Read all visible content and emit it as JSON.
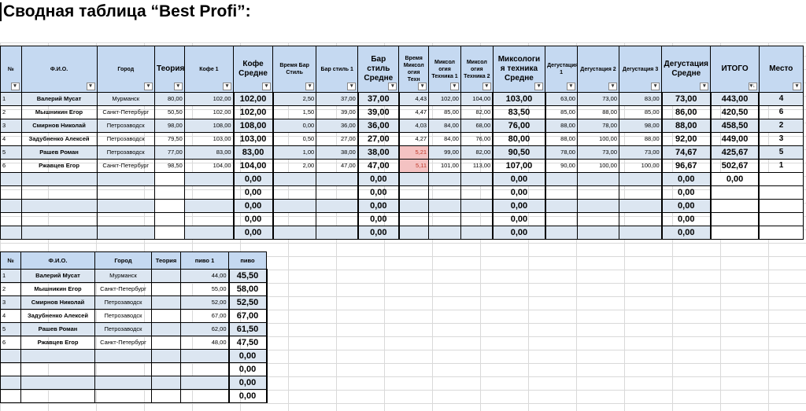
{
  "title": "Сводная таблица “Best Profi”:",
  "table1": {
    "headers": {
      "num": "№",
      "fio": "Ф.И.О.",
      "city": "Город",
      "theory": "Теория",
      "coffee1": "Кофе 1",
      "coffee_avg": "Кофе Средне",
      "time_bar": "Время Бар Стиль",
      "bar1": "Бар стиль 1",
      "bar_avg": "Бар стиль Средне",
      "time_mix": "Время Миксол огия Техн",
      "mix1": "Миксол огия Техника 1",
      "mix2": "Миксол огия Техника 2",
      "mix_avg": "Миксологи я техника Средне",
      "deg1": "Дегустация 1",
      "deg2": "Дегустация 2",
      "deg3": "Дегустация 3",
      "deg_avg": "Дегустация Средне",
      "total": "ИТОГО",
      "place": "Место"
    },
    "rows": [
      {
        "n": "1",
        "fio": "Валерий Мусат",
        "city": "Мурманск",
        "theory": "80,00",
        "coffee1": "102,00",
        "coffee_avg": "102,00",
        "time_bar": "2,50",
        "bar1": "37,00",
        "bar_avg": "37,00",
        "time_mix": "4,43",
        "mix1": "102,00",
        "mix2": "104,00",
        "mix_avg": "103,00",
        "deg1": "63,00",
        "deg2": "73,00",
        "deg3": "83,00",
        "deg_avg": "73,00",
        "total": "443,00",
        "place": "4"
      },
      {
        "n": "2",
        "fio": "Мышникин Егор",
        "city": "Санкт-Петербург",
        "theory": "50,50",
        "coffee1": "102,00",
        "coffee_avg": "102,00",
        "time_bar": "1,50",
        "bar1": "39,00",
        "bar_avg": "39,00",
        "time_mix": "4,47",
        "mix1": "85,00",
        "mix2": "82,00",
        "mix_avg": "83,50",
        "deg1": "85,00",
        "deg2": "88,00",
        "deg3": "85,00",
        "deg_avg": "86,00",
        "total": "420,50",
        "place": "6"
      },
      {
        "n": "3",
        "fio": "Смирнов Николай",
        "city": "Петрозаводск",
        "theory": "98,00",
        "coffee1": "108,00",
        "coffee_avg": "108,00",
        "time_bar": "0,00",
        "bar1": "36,00",
        "bar_avg": "36,00",
        "time_mix": "4,03",
        "mix1": "84,00",
        "mix2": "68,00",
        "mix_avg": "76,00",
        "deg1": "88,00",
        "deg2": "78,00",
        "deg3": "98,00",
        "deg_avg": "88,00",
        "total": "458,50",
        "place": "2"
      },
      {
        "n": "4",
        "fio": "Задубненко Алексей",
        "city": "Петрозаводск",
        "theory": "79,50",
        "coffee1": "103,00",
        "coffee_avg": "103,00",
        "time_bar": "0,50",
        "bar1": "27,00",
        "bar_avg": "27,00",
        "time_mix": "4,27",
        "mix1": "84,00",
        "mix2": "76,00",
        "mix_avg": "80,00",
        "deg1": "88,00",
        "deg2": "100,00",
        "deg3": "88,00",
        "deg_avg": "92,00",
        "total": "449,00",
        "place": "3"
      },
      {
        "n": "5",
        "fio": "Рашев Роман",
        "city": "Петрозаводск",
        "theory": "77,00",
        "coffee1": "83,00",
        "coffee_avg": "83,00",
        "time_bar": "1,00",
        "bar1": "38,00",
        "bar_avg": "38,00",
        "time_mix": "5,21",
        "mix1": "99,00",
        "mix2": "82,00",
        "mix_avg": "90,50",
        "deg1": "78,00",
        "deg2": "73,00",
        "deg3": "73,00",
        "deg_avg": "74,67",
        "total": "425,67",
        "place": "5"
      },
      {
        "n": "6",
        "fio": "Ржавцев Егор",
        "city": "Санкт-Петербург",
        "theory": "98,50",
        "coffee1": "104,00",
        "coffee_avg": "104,00",
        "time_bar": "2,00",
        "bar1": "47,00",
        "bar_avg": "47,00",
        "time_mix": "5,11",
        "mix1": "101,00",
        "mix2": "113,00",
        "mix_avg": "107,00",
        "deg1": "90,00",
        "deg2": "100,00",
        "deg3": "100,00",
        "deg_avg": "96,67",
        "total": "502,67",
        "place": "1"
      },
      {
        "n": "",
        "fio": "",
        "city": "",
        "theory": "",
        "coffee1": "",
        "coffee_avg": "0,00",
        "time_bar": "",
        "bar1": "",
        "bar_avg": "0,00",
        "time_mix": "",
        "mix1": "",
        "mix2": "",
        "mix_avg": "0,00",
        "deg1": "",
        "deg2": "",
        "deg3": "",
        "deg_avg": "0,00",
        "total": "0,00",
        "place": ""
      },
      {
        "n": "",
        "fio": "",
        "city": "",
        "theory": "",
        "coffee1": "",
        "coffee_avg": "0,00",
        "time_bar": "",
        "bar1": "",
        "bar_avg": "0,00",
        "time_mix": "",
        "mix1": "",
        "mix2": "",
        "mix_avg": "0,00",
        "deg1": "",
        "deg2": "",
        "deg3": "",
        "deg_avg": "0,00",
        "total": "",
        "place": ""
      },
      {
        "n": "",
        "fio": "",
        "city": "",
        "theory": "",
        "coffee1": "",
        "coffee_avg": "0,00",
        "time_bar": "",
        "bar1": "",
        "bar_avg": "0,00",
        "time_mix": "",
        "mix1": "",
        "mix2": "",
        "mix_avg": "0,00",
        "deg1": "",
        "deg2": "",
        "deg3": "",
        "deg_avg": "0,00",
        "total": "",
        "place": ""
      },
      {
        "n": "",
        "fio": "",
        "city": "",
        "theory": "",
        "coffee1": "",
        "coffee_avg": "0,00",
        "time_bar": "",
        "bar1": "",
        "bar_avg": "0,00",
        "time_mix": "",
        "mix1": "",
        "mix2": "",
        "mix_avg": "0,00",
        "deg1": "",
        "deg2": "",
        "deg3": "",
        "deg_avg": "0,00",
        "total": "",
        "place": ""
      },
      {
        "n": "",
        "fio": "",
        "city": "",
        "theory": "",
        "coffee1": "",
        "coffee_avg": "0,00",
        "time_bar": "",
        "bar1": "",
        "bar_avg": "0,00",
        "time_mix": "",
        "mix1": "",
        "mix2": "",
        "mix_avg": "0,00",
        "deg1": "",
        "deg2": "",
        "deg3": "",
        "deg_avg": "0,00",
        "total": "",
        "place": ""
      }
    ]
  },
  "table2": {
    "headers": {
      "num": "№",
      "fio": "Ф.И.О.",
      "city": "Город",
      "theory": "Теория",
      "beer1": "пиво 1",
      "beer": "пиво"
    },
    "rows": [
      {
        "n": "1",
        "fio": "Валерий Мусат",
        "city": "Мурманск",
        "theory": "",
        "beer1": "44,00",
        "beer": "45,50"
      },
      {
        "n": "2",
        "fio": "Мышникин Егор",
        "city": "Санкт-Петербург",
        "theory": "",
        "beer1": "55,00",
        "beer": "58,00"
      },
      {
        "n": "3",
        "fio": "Смирнов Николай",
        "city": "Петрозаводск",
        "theory": "",
        "beer1": "52,00",
        "beer": "52,50"
      },
      {
        "n": "4",
        "fio": "Задубненко Алексей",
        "city": "Петрозаводск",
        "theory": "",
        "beer1": "67,00",
        "beer": "67,00"
      },
      {
        "n": "5",
        "fio": "Рашев Роман",
        "city": "Петрозаводск",
        "theory": "",
        "beer1": "62,00",
        "beer": "61,50"
      },
      {
        "n": "6",
        "fio": "Ржавцев Егор",
        "city": "Санкт-Петербург",
        "theory": "",
        "beer1": "48,00",
        "beer": "47,50"
      },
      {
        "n": "",
        "fio": "",
        "city": "",
        "theory": "",
        "beer1": "",
        "beer": "0,00"
      },
      {
        "n": "",
        "fio": "",
        "city": "",
        "theory": "",
        "beer1": "",
        "beer": "0,00"
      },
      {
        "n": "",
        "fio": "",
        "city": "",
        "theory": "",
        "beer1": "",
        "beer": "0,00"
      },
      {
        "n": "",
        "fio": "",
        "city": "",
        "theory": "",
        "beer1": "",
        "beer": "0,00"
      }
    ]
  },
  "highlight_color": "#f4c2c2",
  "header_color": "#c5d9f1",
  "band_color": "#dce6f1"
}
